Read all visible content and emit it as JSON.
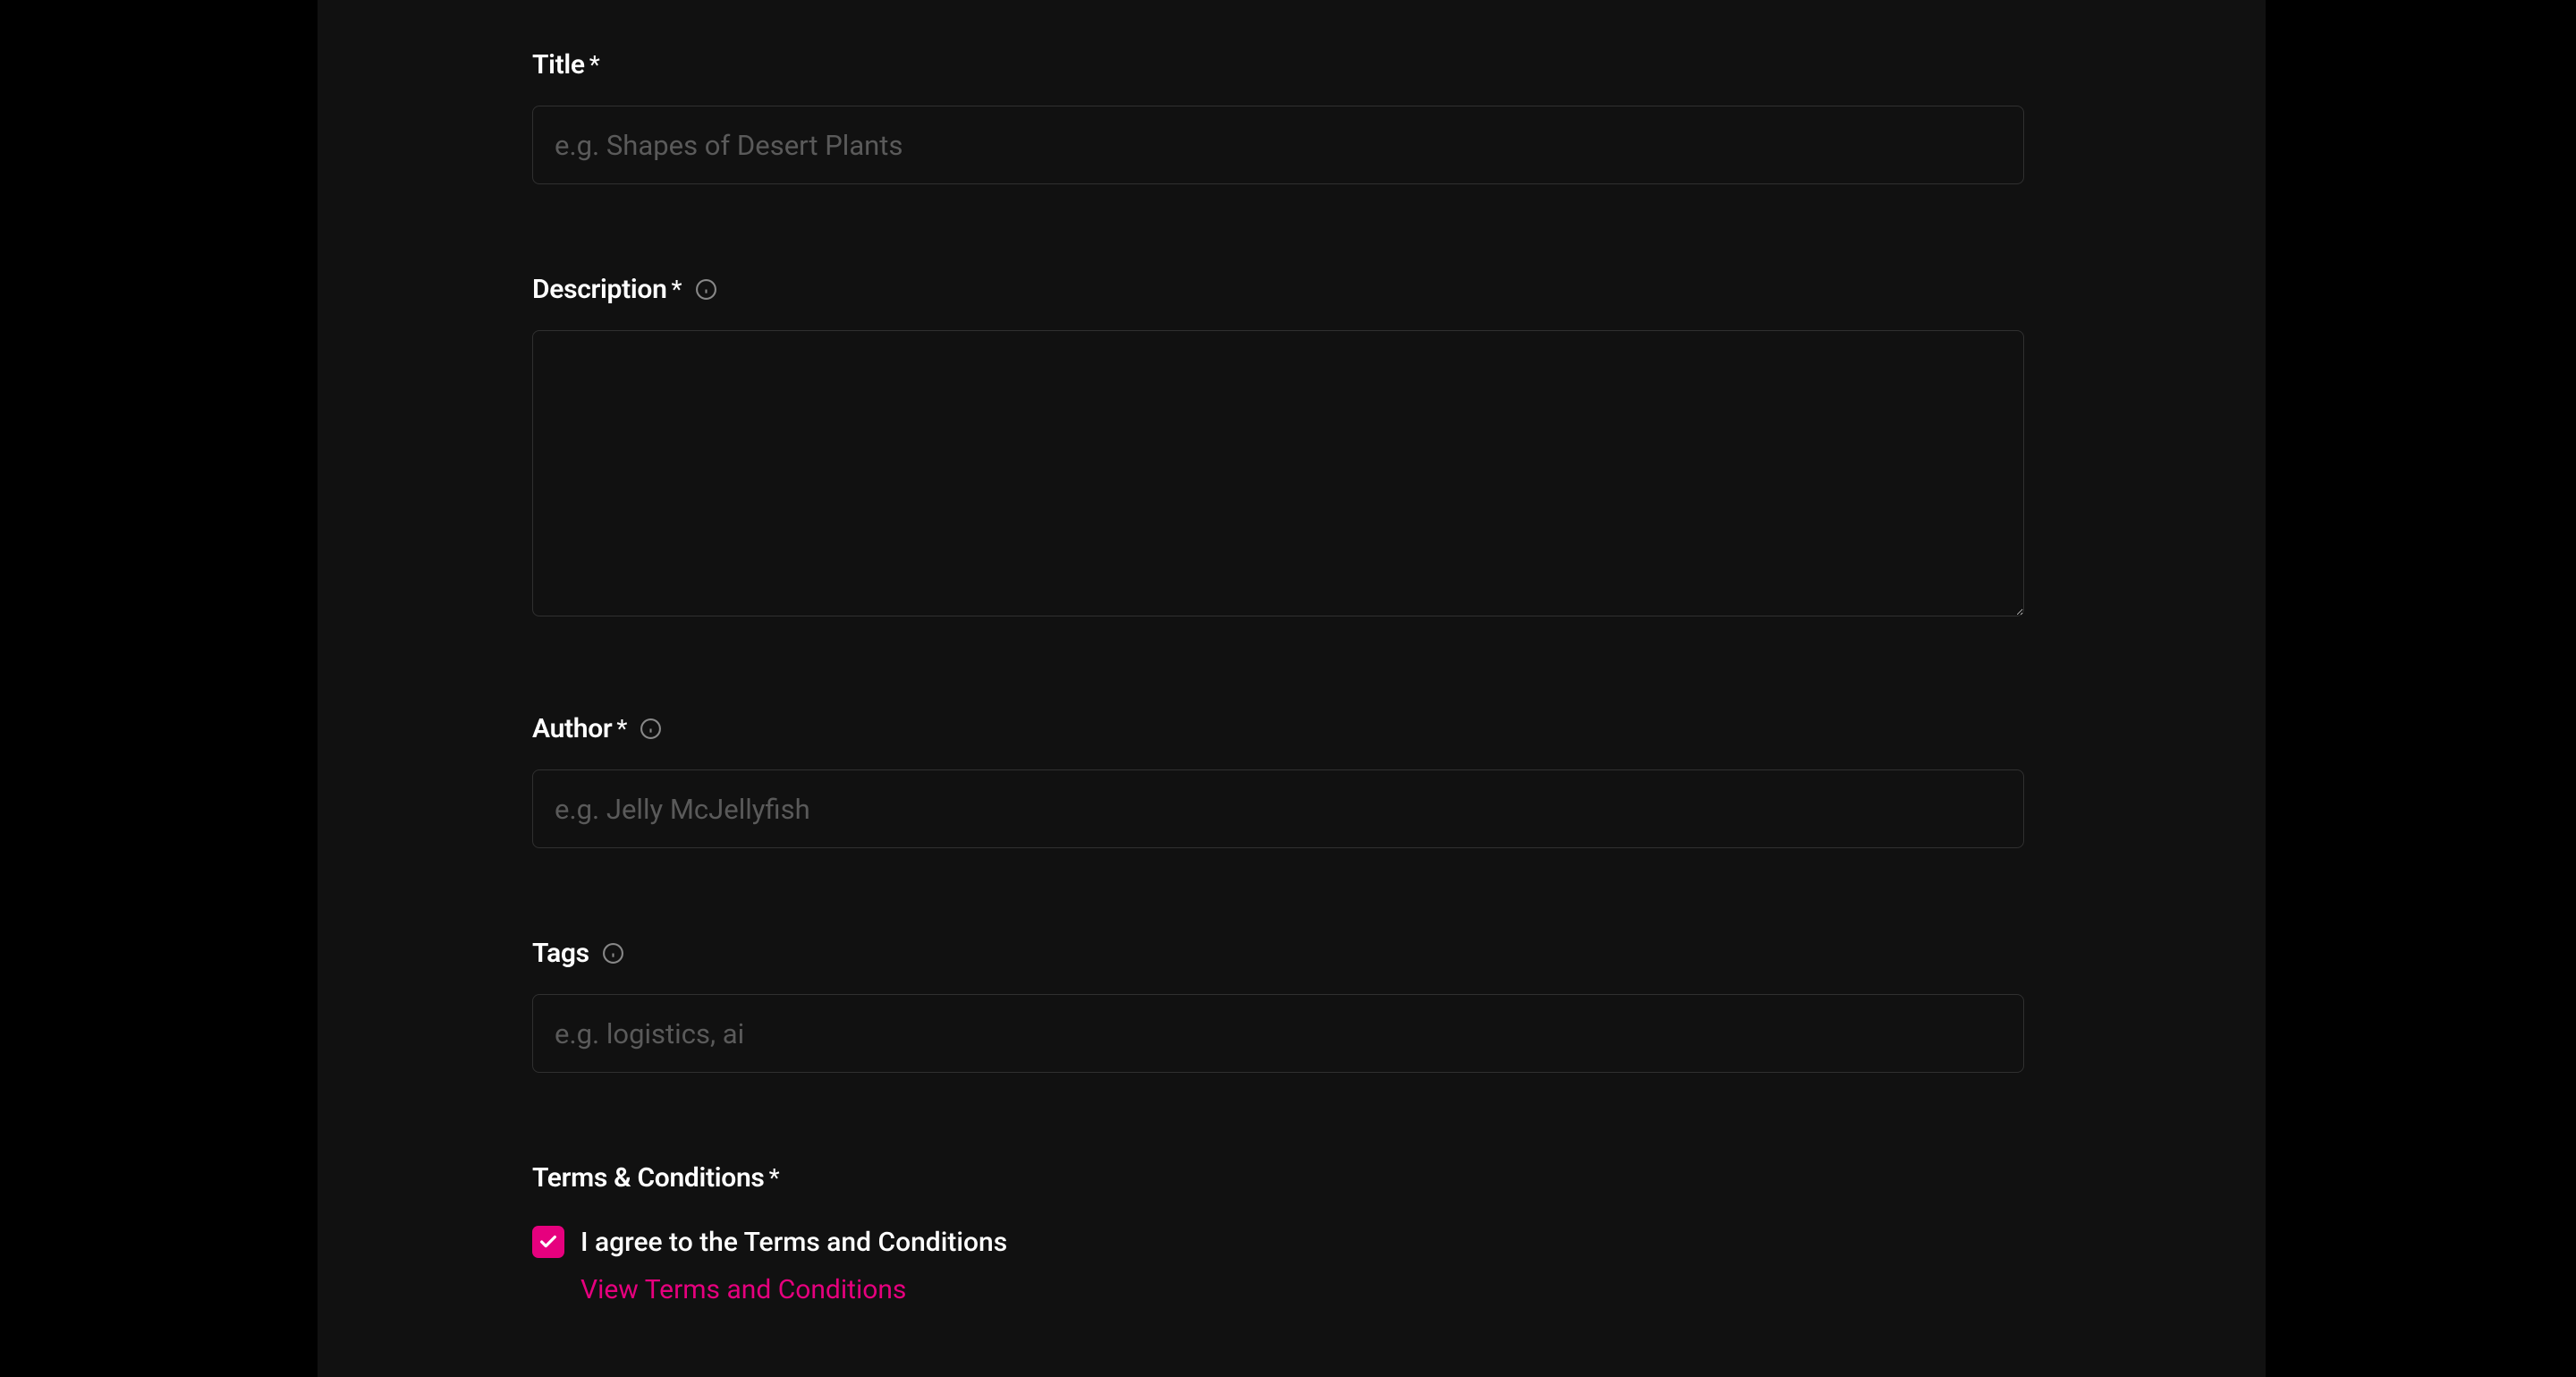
{
  "form": {
    "title": {
      "label": "Title",
      "required": "*",
      "placeholder": "e.g. Shapes of Desert Plants",
      "value": ""
    },
    "description": {
      "label": "Description",
      "required": "*",
      "placeholder": "",
      "value": ""
    },
    "author": {
      "label": "Author",
      "required": "*",
      "placeholder": "e.g. Jelly McJellyfish",
      "value": ""
    },
    "tags": {
      "label": "Tags",
      "placeholder": "e.g. logistics, ai",
      "value": ""
    },
    "terms": {
      "label": "Terms & Conditions",
      "required": "*",
      "checkbox_label": "I agree to the Terms and Conditions",
      "checked": true,
      "link_text": "View Terms and Conditions"
    }
  }
}
